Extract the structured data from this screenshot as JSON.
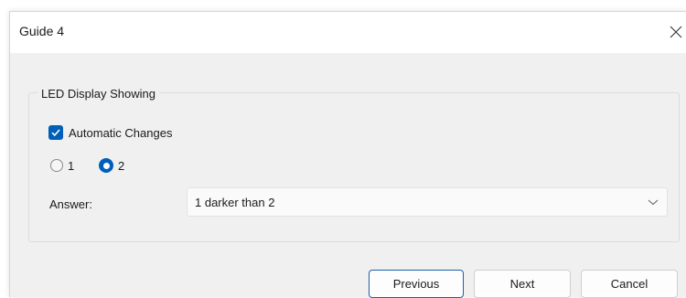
{
  "window": {
    "title": "Guide 4",
    "close_icon": "close-icon"
  },
  "group": {
    "label": "LED Display Showing"
  },
  "checkbox": {
    "label": "Automatic Changes",
    "checked": true
  },
  "radios": [
    {
      "label": "1",
      "selected": false
    },
    {
      "label": "2",
      "selected": true
    }
  ],
  "answer": {
    "label": "Answer:",
    "value": "1 darker than 2"
  },
  "buttons": {
    "previous": "Previous",
    "next": "Next",
    "cancel": "Cancel"
  },
  "colors": {
    "accent": "#005fb8",
    "client_bg": "#f0f0f0"
  }
}
